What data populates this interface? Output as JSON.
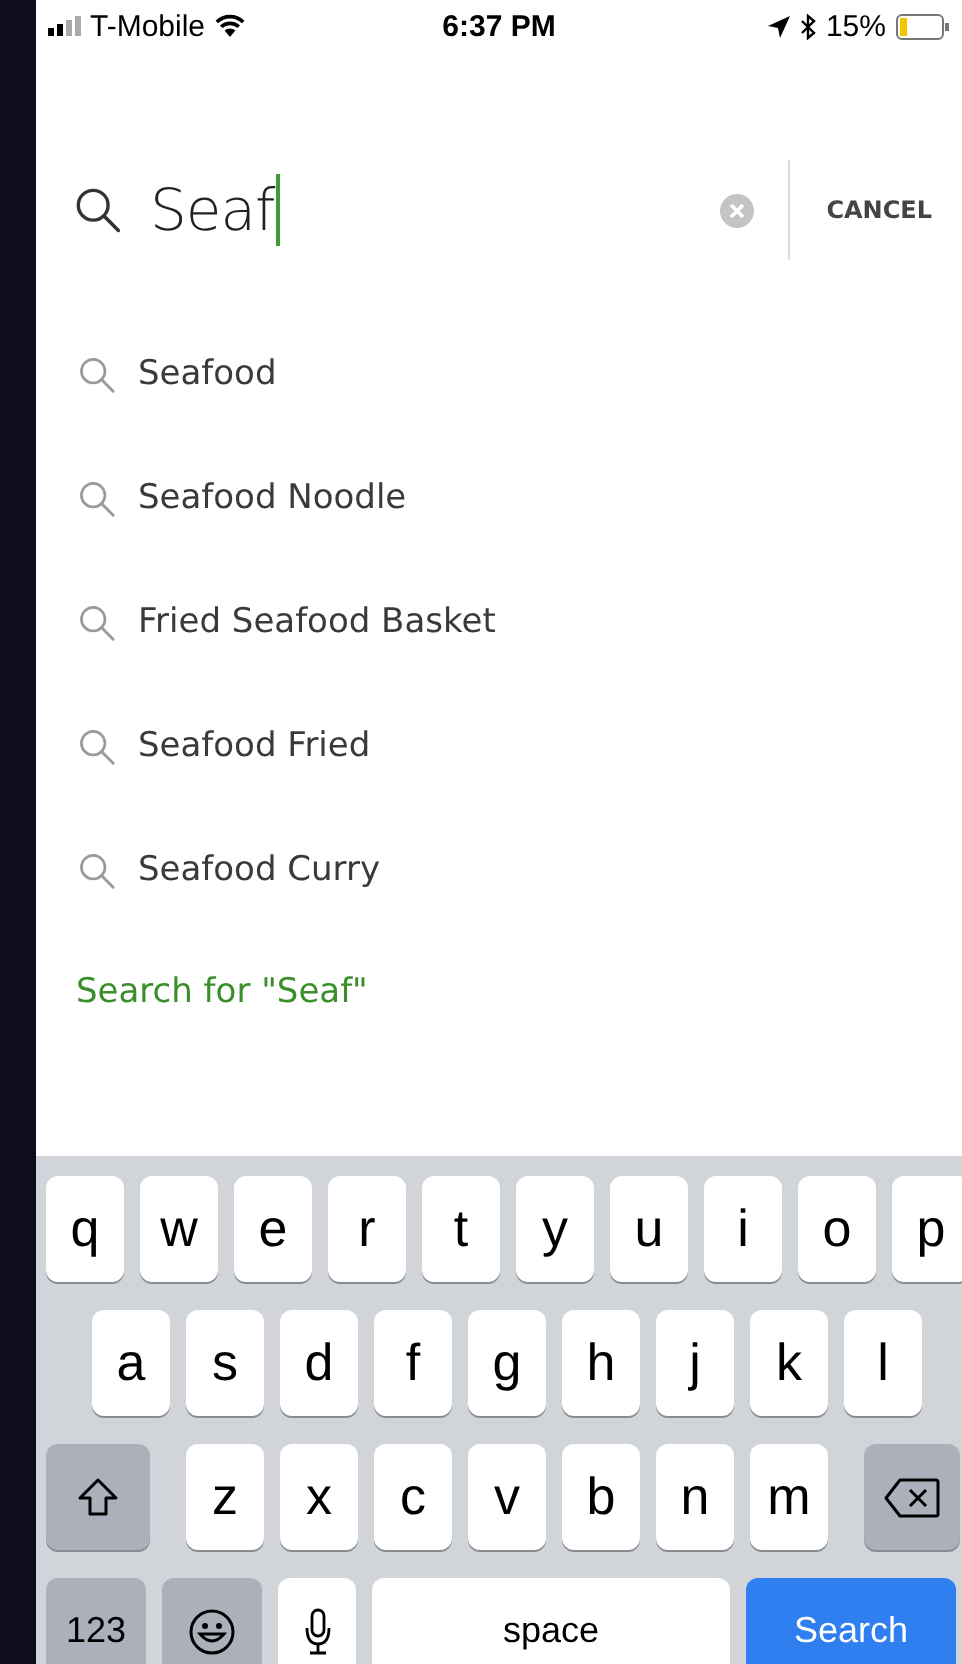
{
  "status_bar": {
    "carrier": "T-Mobile",
    "time": "6:37 PM",
    "battery": "15%"
  },
  "search": {
    "value": "Seaf",
    "cancel": "CANCEL"
  },
  "suggestions": [
    {
      "label": "Seafood"
    },
    {
      "label": "Seafood Noodle"
    },
    {
      "label": "Fried Seafood Basket"
    },
    {
      "label": "Seafood Fried"
    },
    {
      "label": "Seafood Curry"
    }
  ],
  "search_for": "Search for \"Seaf\"",
  "keyboard": {
    "rows": [
      [
        {
          "kind": "letter",
          "label": "q"
        },
        {
          "kind": "letter",
          "label": "w"
        },
        {
          "kind": "letter",
          "label": "e"
        },
        {
          "kind": "letter",
          "label": "r"
        },
        {
          "kind": "letter",
          "label": "t"
        },
        {
          "kind": "letter",
          "label": "y"
        },
        {
          "kind": "letter",
          "label": "u"
        },
        {
          "kind": "letter",
          "label": "i"
        },
        {
          "kind": "letter",
          "label": "o"
        },
        {
          "kind": "letter",
          "label": "p"
        }
      ],
      [
        {
          "kind": "letter",
          "label": "a"
        },
        {
          "kind": "letter",
          "label": "s"
        },
        {
          "kind": "letter",
          "label": "d"
        },
        {
          "kind": "letter",
          "label": "f"
        },
        {
          "kind": "letter",
          "label": "g"
        },
        {
          "kind": "letter",
          "label": "h"
        },
        {
          "kind": "letter",
          "label": "j"
        },
        {
          "kind": "letter",
          "label": "k"
        },
        {
          "kind": "letter",
          "label": "l"
        }
      ],
      [
        {
          "kind": "shift"
        },
        {
          "kind": "letter",
          "label": "z"
        },
        {
          "kind": "letter",
          "label": "x"
        },
        {
          "kind": "letter",
          "label": "c"
        },
        {
          "kind": "letter",
          "label": "v"
        },
        {
          "kind": "letter",
          "label": "b"
        },
        {
          "kind": "letter",
          "label": "n"
        },
        {
          "kind": "letter",
          "label": "m"
        },
        {
          "kind": "delete"
        }
      ]
    ],
    "bottom_row": [
      {
        "kind": "numbers",
        "label": "123"
      },
      {
        "kind": "emoji"
      },
      {
        "kind": "mic"
      },
      {
        "kind": "space",
        "label": "space"
      },
      {
        "kind": "action",
        "label": "Search"
      }
    ]
  }
}
